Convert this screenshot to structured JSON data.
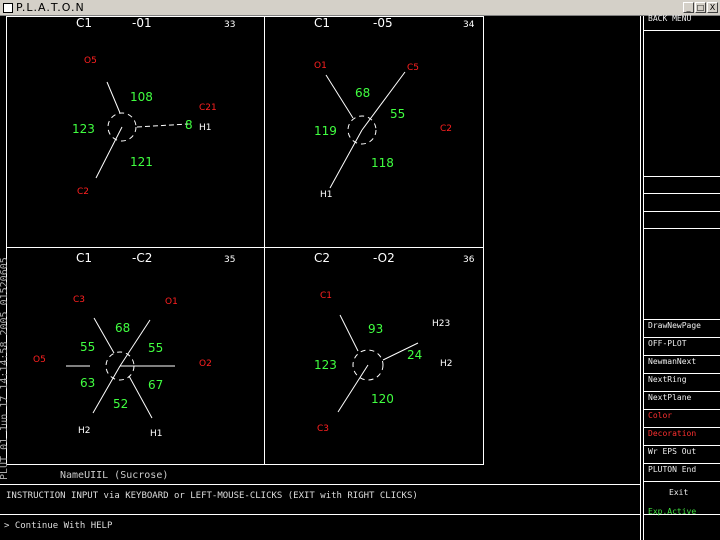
{
  "window": {
    "title": "P.L.A.T.O.N",
    "buttons": [
      "_",
      "□",
      "X"
    ]
  },
  "panels": [
    {
      "atom": "C1",
      "index": "-01",
      "number": "33",
      "angles": [
        "108",
        "123",
        "121",
        "8"
      ],
      "labels": [
        {
          "text": "O5",
          "color": "red"
        },
        {
          "text": "C21",
          "color": "red"
        },
        {
          "text": "H1",
          "color": "white"
        },
        {
          "text": "C2",
          "color": "red"
        }
      ]
    },
    {
      "atom": "C1",
      "index": "-05",
      "number": "34",
      "angles": [
        "68",
        "55",
        "119",
        "118"
      ],
      "labels": [
        {
          "text": "O1",
          "color": "red"
        },
        {
          "text": "C5",
          "color": "red"
        },
        {
          "text": "C2",
          "color": "red"
        },
        {
          "text": "H1",
          "color": "white"
        }
      ]
    },
    {
      "atom": "C1",
      "index": "-C2",
      "number": "35",
      "angles": [
        "68",
        "55",
        "55",
        "63",
        "67",
        "52"
      ],
      "labels": [
        {
          "text": "C3",
          "color": "red"
        },
        {
          "text": "O1",
          "color": "red"
        },
        {
          "text": "O5",
          "color": "red"
        },
        {
          "text": "O2",
          "color": "red"
        },
        {
          "text": "H2",
          "color": "white"
        },
        {
          "text": "H1",
          "color": "white"
        }
      ]
    },
    {
      "atom": "C2",
      "index": "-O2",
      "number": "36",
      "angles": [
        "93",
        "123",
        "24",
        "120"
      ],
      "labels": [
        {
          "text": "C1",
          "color": "red"
        },
        {
          "text": "H23",
          "color": "white"
        },
        {
          "text": "H2",
          "color": "white"
        },
        {
          "text": "C3",
          "color": "red"
        }
      ]
    }
  ],
  "footer": {
    "vertical_label": "PLUT 01 Jun 17 14:14:58 2005   01520605",
    "molecule_name": "NameUIIL  (Sucrose)",
    "instruction": "INSTRUCTION INPUT via KEYBOARD or LEFT-MOUSE-CLICKS (EXIT with RIGHT CLICKS)",
    "prompt": "> Continue With HELP"
  },
  "menu": [
    {
      "label": "BACK   MENU",
      "color": "white"
    },
    {
      "label": "",
      "color": "white"
    },
    {
      "label": "",
      "color": "white"
    },
    {
      "label": "",
      "color": "white"
    },
    {
      "label": "",
      "color": "white"
    },
    {
      "label": "",
      "color": "white"
    },
    {
      "label": "",
      "color": "white"
    },
    {
      "label": "",
      "color": "white"
    },
    {
      "label": "",
      "color": "white"
    },
    {
      "label": "",
      "color": "white"
    },
    {
      "label": "",
      "color": "white"
    },
    {
      "label": "",
      "color": "white"
    },
    {
      "label": "",
      "color": "white"
    },
    {
      "label": "",
      "color": "white"
    },
    {
      "label": "",
      "color": "white"
    },
    {
      "label": "",
      "color": "white"
    },
    {
      "label": "DrawNewPage",
      "color": "white"
    },
    {
      "label": "OFF-PLOT",
      "color": "white"
    },
    {
      "label": "NewmanNext",
      "color": "white"
    },
    {
      "label": "NextRing",
      "color": "white"
    },
    {
      "label": "NextPlane",
      "color": "white"
    },
    {
      "label": "Color",
      "color": "red"
    },
    {
      "label": "Decoration",
      "color": "red"
    },
    {
      "label": "Wr EPS Out",
      "color": "white"
    },
    {
      "label": "PLUTON  End",
      "color": "white"
    },
    {
      "label": "Exit",
      "color": "white"
    },
    {
      "label": "Exp.Active",
      "color": "green"
    }
  ],
  "colors": {
    "grid": "#ffffff",
    "angle": "#40ff40",
    "atom_red": "#ff2020",
    "atom_white": "#ffffff"
  }
}
